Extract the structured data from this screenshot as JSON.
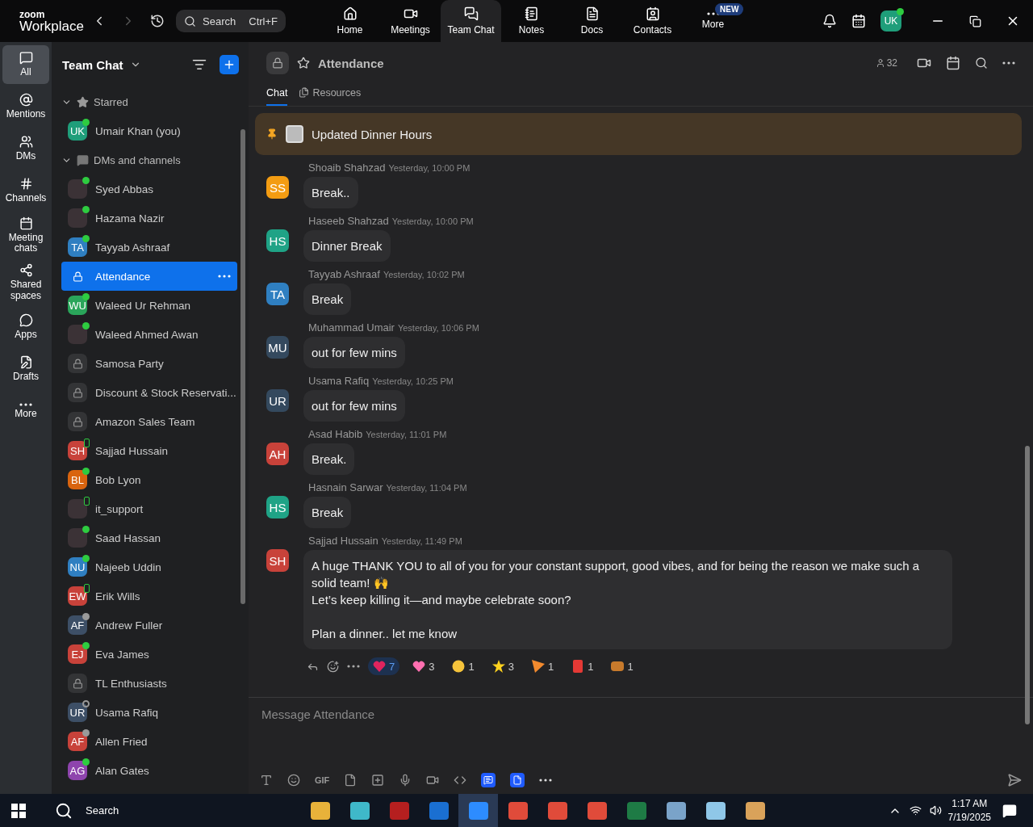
{
  "topbar": {
    "logo_top": "zoom",
    "logo_bottom": "Workplace",
    "search": {
      "placeholder": "Search",
      "shortcut": "Ctrl+F"
    },
    "nav": [
      {
        "label": "Home",
        "selected": false
      },
      {
        "label": "Meetings",
        "selected": false
      },
      {
        "label": "Team Chat",
        "selected": true
      },
      {
        "label": "Notes",
        "selected": false
      },
      {
        "label": "Docs",
        "selected": false
      },
      {
        "label": "Contacts",
        "selected": false
      },
      {
        "label": "More",
        "selected": false,
        "badge": "NEW"
      }
    ],
    "avatar": "UK"
  },
  "rail": [
    {
      "label": "All",
      "selected": true
    },
    {
      "label": "Mentions",
      "selected": false
    },
    {
      "label": "DMs",
      "selected": false
    },
    {
      "label": "Channels",
      "selected": false
    },
    {
      "label": "Meeting chats",
      "selected": false
    },
    {
      "label": "Shared spaces",
      "selected": false
    },
    {
      "label": "Apps",
      "selected": false
    },
    {
      "label": "Drafts",
      "selected": false
    },
    {
      "label": "More",
      "selected": false
    }
  ],
  "sidebar": {
    "title": "Team Chat",
    "sections": [
      {
        "label": "Starred",
        "expanded": true,
        "items": [
          {
            "name": "Umair Khan (you)",
            "kind": "initials",
            "initials": "UK",
            "color": "#1f9e7a",
            "presence": {
              "kind": "dot",
              "color": "#2ecc40"
            },
            "selected": false
          }
        ]
      },
      {
        "label": "DMs and channels",
        "expanded": true,
        "items": [
          {
            "name": "Syed Abbas",
            "kind": "photo",
            "presence": {
              "kind": "dot",
              "color": "#2ecc40"
            },
            "selected": false
          },
          {
            "name": "Hazama Nazir",
            "kind": "photo",
            "presence": {
              "kind": "dot",
              "color": "#2ecc40"
            },
            "selected": false
          },
          {
            "name": "Tayyab Ashraaf",
            "kind": "initials",
            "initials": "TA",
            "color": "#2f7fc1",
            "presence": {
              "kind": "dot",
              "color": "#2ecc40"
            },
            "selected": false
          },
          {
            "name": "Attendance",
            "kind": "channel",
            "selected": true
          },
          {
            "name": "Waleed Ur Rehman",
            "kind": "initials",
            "initials": "WU",
            "color": "#2aa55a",
            "presence": {
              "kind": "dot",
              "color": "#2ecc40"
            },
            "selected": false
          },
          {
            "name": "Waleed Ahmed Awan",
            "kind": "photo",
            "presence": {
              "kind": "dot",
              "color": "#2ecc40"
            },
            "selected": false
          },
          {
            "name": "Samosa Party",
            "kind": "channel",
            "selected": false
          },
          {
            "name": "Discount & Stock Reservati...",
            "kind": "channel",
            "selected": false
          },
          {
            "name": "Amazon Sales Team",
            "kind": "channel",
            "selected": false
          },
          {
            "name": "Sajjad Hussain",
            "kind": "initials",
            "initials": "SH",
            "color": "#c8423a",
            "presence": {
              "kind": "phone",
              "color": "#2ecc40"
            },
            "selected": false
          },
          {
            "name": "Bob Lyon",
            "kind": "initials",
            "initials": "BL",
            "color": "#d9640f",
            "presence": {
              "kind": "dot",
              "color": "#2ecc40"
            },
            "selected": false
          },
          {
            "name": "it_support",
            "kind": "photo",
            "presence": {
              "kind": "phone",
              "color": "#2ecc40"
            },
            "selected": false
          },
          {
            "name": "Saad Hassan",
            "kind": "photo",
            "presence": {
              "kind": "dot",
              "color": "#2ecc40"
            },
            "selected": false
          },
          {
            "name": "Najeeb Uddin",
            "kind": "initials",
            "initials": "NU",
            "color": "#2f7fc1",
            "presence": {
              "kind": "dot",
              "color": "#2ecc40"
            },
            "selected": false
          },
          {
            "name": "Erik Wills",
            "kind": "initials",
            "initials": "EW",
            "color": "#c8423a",
            "presence": {
              "kind": "phone",
              "color": "#2ecc40"
            },
            "selected": false
          },
          {
            "name": "Andrew Fuller",
            "kind": "initials",
            "initials": "AF",
            "color": "#3d4f66",
            "presence": {
              "kind": "dot",
              "color": "#9a9a9a"
            },
            "selected": false
          },
          {
            "name": "Eva James",
            "kind": "initials",
            "initials": "EJ",
            "color": "#c8423a",
            "presence": {
              "kind": "dot",
              "color": "#2ecc40"
            },
            "selected": false
          },
          {
            "name": "TL Enthusiasts",
            "kind": "channel",
            "selected": false
          },
          {
            "name": "Usama Rafiq",
            "kind": "initials",
            "initials": "UR",
            "color": "#3d4f66",
            "presence": {
              "kind": "ring",
              "color": "#9a9a9a"
            },
            "selected": false
          },
          {
            "name": "Allen Fried",
            "kind": "initials",
            "initials": "AF",
            "color": "#c8423a",
            "presence": {
              "kind": "dot",
              "color": "#9a9a9a"
            },
            "selected": false
          },
          {
            "name": "Alan Gates",
            "kind": "initials",
            "initials": "AG",
            "color": "#8e44ad",
            "presence": {
              "kind": "dot",
              "color": "#2ecc40"
            },
            "selected": false
          }
        ]
      }
    ]
  },
  "chat": {
    "title": "Attendance",
    "starred": false,
    "members": "32",
    "tabs": [
      {
        "label": "Chat",
        "selected": true
      },
      {
        "label": "Resources",
        "selected": false
      }
    ],
    "pinned": "Updated Dinner Hours",
    "messages": [
      {
        "sender": "Shoaib Shahzad",
        "time": "Yesterday, 10:00 PM",
        "initials": "SS",
        "color": "#f39c12",
        "paragraphs": [
          [
            "Break.."
          ]
        ]
      },
      {
        "sender": "Haseeb Shahzad",
        "time": "Yesterday, 10:00 PM",
        "initials": "HS",
        "color": "#1fa386",
        "paragraphs": [
          [
            "Dinner Break"
          ]
        ]
      },
      {
        "sender": "Tayyab Ashraaf",
        "time": "Yesterday, 10:02 PM",
        "initials": "TA",
        "color": "#2f7fc1",
        "paragraphs": [
          [
            "Break"
          ]
        ]
      },
      {
        "sender": "Muhammad Umair",
        "time": "Yesterday, 10:06 PM",
        "initials": "MU",
        "color": "#34495e",
        "paragraphs": [
          [
            "out for few mins"
          ]
        ]
      },
      {
        "sender": "Usama Rafiq",
        "time": "Yesterday, 10:25 PM",
        "initials": "UR",
        "color": "#34495e",
        "paragraphs": [
          [
            "out for few mins"
          ]
        ]
      },
      {
        "sender": "Asad Habib",
        "time": "Yesterday, 11:01 PM",
        "initials": "AH",
        "color": "#c8423a",
        "paragraphs": [
          [
            "Break."
          ]
        ]
      },
      {
        "sender": "Hasnain Sarwar",
        "time": "Yesterday, 11:04 PM",
        "initials": "HS",
        "color": "#1fa386",
        "paragraphs": [
          [
            "Break"
          ]
        ]
      },
      {
        "sender": "Sajjad Hussain",
        "time": "Yesterday, 11:49 PM",
        "initials": "SH",
        "color": "#c8423a",
        "paragraphs": [
          [
            "A huge THANK YOU to all of you for your constant support, good vibes, and for being the reason we make such a solid team! 🙌",
            "Let’s keep killing it—and maybe celebrate soon?"
          ],
          [
            "Plan a dinner.. let me know"
          ]
        ],
        "reactions": [
          {
            "kind": "red-heart",
            "count": "7",
            "selected": true
          },
          {
            "kind": "pink-heart",
            "count": "3",
            "selected": false
          },
          {
            "kind": "face",
            "count": "1",
            "selected": false
          },
          {
            "kind": "sun",
            "count": "3",
            "selected": false
          },
          {
            "kind": "pizza",
            "count": "1",
            "selected": false
          },
          {
            "kind": "fries",
            "count": "1",
            "selected": false
          },
          {
            "kind": "burger",
            "count": "1",
            "selected": false
          }
        ]
      }
    ],
    "composer": {
      "placeholder": "Message Attendance",
      "gif": "GIF"
    }
  },
  "taskbar": {
    "search": "Search",
    "time": "1:17 AM",
    "date": "7/19/2025"
  }
}
